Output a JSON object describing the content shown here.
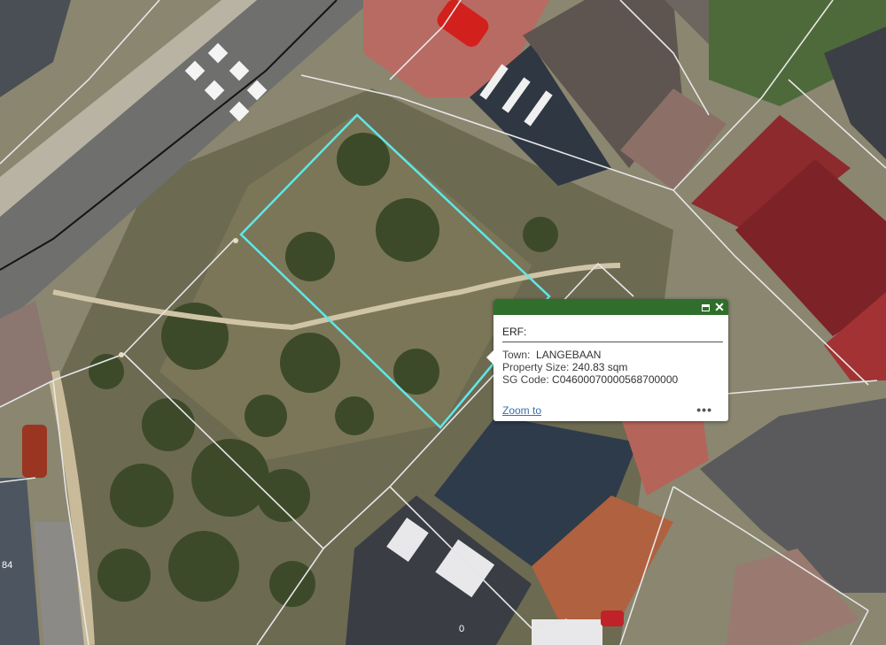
{
  "popup": {
    "title": "ERF:",
    "fields": [
      {
        "label": "Town:",
        "value": "LANGEBAAN"
      },
      {
        "label": "Property Size:",
        "value": "240.83 sqm"
      },
      {
        "label": "SG Code:",
        "value": "C04600070000568700000"
      }
    ],
    "zoom_label": "Zoom to",
    "more_label": "•••",
    "maximize_icon": "maximize-icon",
    "close_icon": "close-icon",
    "close_glyph": "✕"
  },
  "map": {
    "parcel_labels": [
      "84",
      "0"
    ],
    "highlight_color": "#5ee8e8",
    "boundary_color": "#e8e8e8",
    "popup_header_color": "#2f6f2b"
  }
}
